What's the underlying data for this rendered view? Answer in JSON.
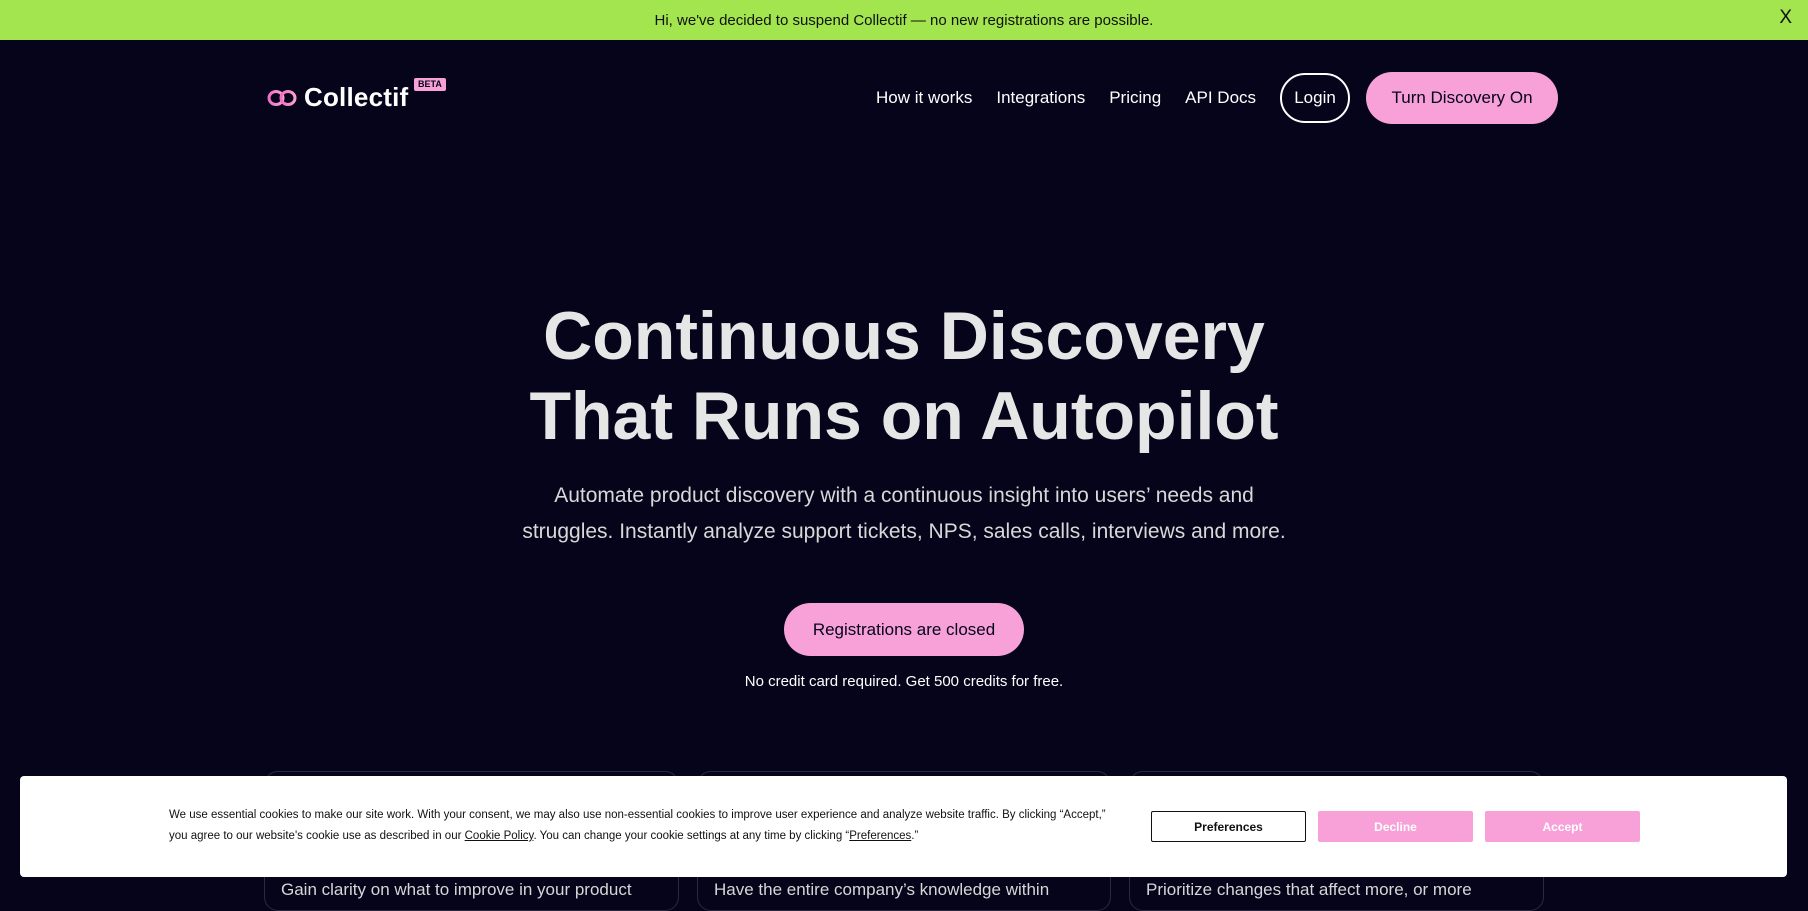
{
  "banner": {
    "message": "Hi, we've decided to suspend Collectif — no new registrations are possible.",
    "close_label": "X"
  },
  "brand": {
    "name": "Collectif",
    "badge": "BETA"
  },
  "nav": {
    "links": [
      "How it works",
      "Integrations",
      "Pricing",
      "API Docs"
    ],
    "login_label": "Login",
    "cta_label": "Turn Discovery On"
  },
  "hero": {
    "title_line1": "Continuous Discovery",
    "title_line2": "That Runs on Autopilot",
    "subtitle_line1": "Automate product discovery with a continuous insight into users’ needs and",
    "subtitle_line2": "struggles. Instantly analyze support tickets, NPS, sales calls, interviews and more.",
    "cta_label": "Registrations are closed",
    "note": "No credit card required. Get 500 credits for free."
  },
  "features": [
    {
      "text": "Gain clarity on what to improve in your product"
    },
    {
      "text": "Have the entire company’s knowledge within"
    },
    {
      "text": "Prioritize changes that affect more, or more"
    }
  ],
  "cookie": {
    "text_part1": "We use essential cookies to make our site work. With your consent, we may also use non-essential cookies to improve user experience and analyze website traffic. By clicking “Accept,” you agree to our website's cookie use as described in our ",
    "policy_link": "Cookie Policy",
    "text_part2": ". You can change your cookie settings at any time by clicking “",
    "preferences_link": "Preferences",
    "text_part3": ".”",
    "preferences_button": "Preferences",
    "decline_button": "Decline",
    "accept_button": "Accept"
  },
  "colors": {
    "background": "#05041a",
    "banner": "#a3e54e",
    "accent_pink": "#f7a1d8"
  },
  "icons": {
    "logo": "infinity-loop-icon"
  }
}
